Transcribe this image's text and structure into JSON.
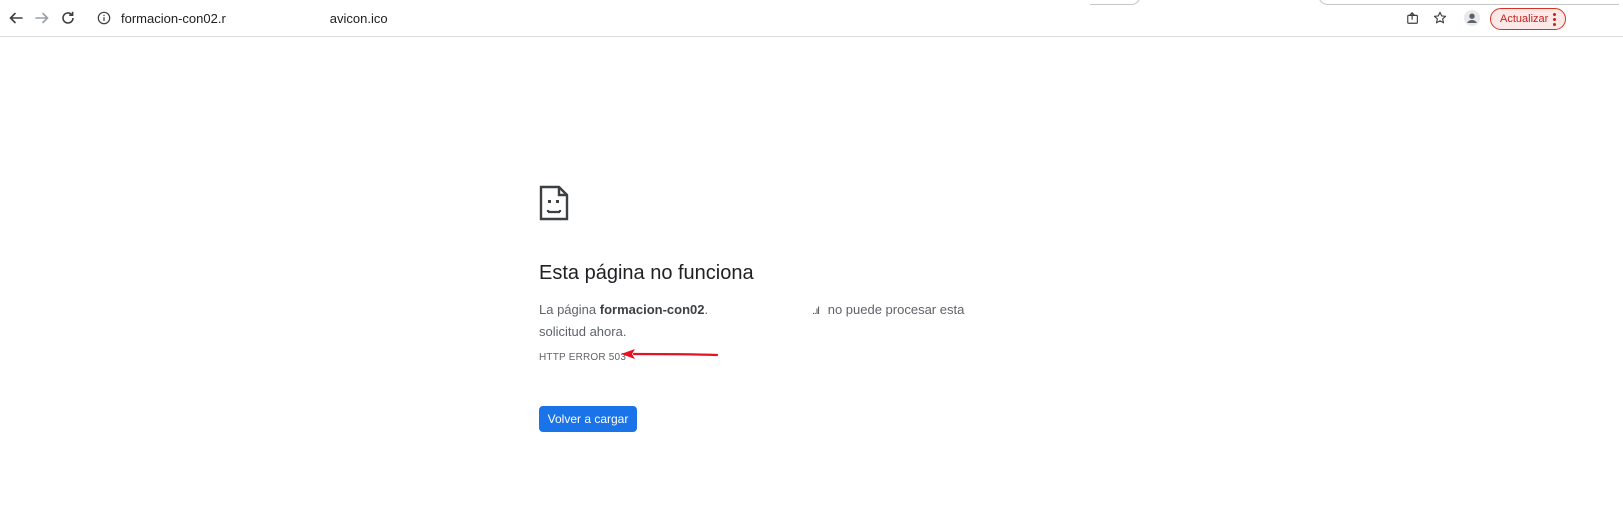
{
  "browser": {
    "url_prefix": "formacion-con02.r",
    "url_suffix": "avicon.ico",
    "update_button_label": "Actualizar",
    "accent_color": "#1a73e8",
    "update_color": "#d93025"
  },
  "icons": {
    "back": "arrow-left-icon",
    "forward": "arrow-right-icon",
    "reload": "reload-icon",
    "site_info": "info-icon",
    "share": "share-icon",
    "bookmark": "star-icon",
    "profile": "profile-icon",
    "menu": "more-vertical-icon",
    "error": "sad-page-icon",
    "annotation": "red-arrow"
  },
  "error_page": {
    "title": "Esta página no funciona",
    "desc_prefix": "La página ",
    "desc_host": "formacion-con02",
    "desc_host_dot": ".",
    "desc_suffix_glyph": "..ıl",
    "desc_rest": " no puede procesar esta solicitud ahora.",
    "error_code": "HTTP ERROR 503",
    "reload_label": "Volver a cargar"
  }
}
